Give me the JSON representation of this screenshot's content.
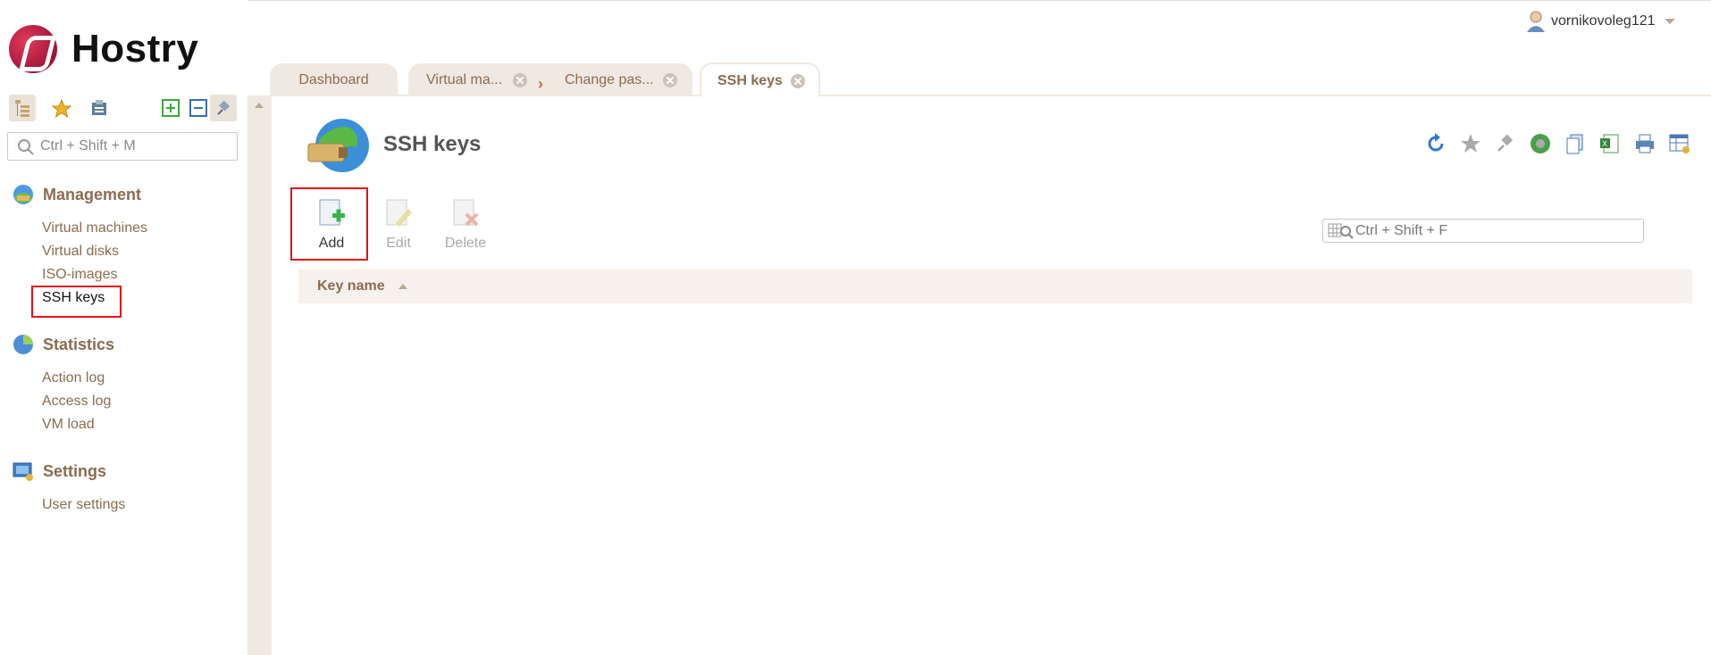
{
  "app": {
    "brand": "Hostry"
  },
  "user": {
    "name": "vornikovoleg121"
  },
  "sidebar": {
    "search_placeholder": "Ctrl + Shift + M",
    "groups": [
      {
        "title": "Management",
        "items": [
          "Virtual machines",
          "Virtual disks",
          "ISO-images",
          "SSH keys"
        ]
      },
      {
        "title": "Statistics",
        "items": [
          "Action log",
          "Access log",
          "VM load"
        ]
      },
      {
        "title": "Settings",
        "items": [
          "User settings"
        ]
      }
    ],
    "selected_item": "SSH keys"
  },
  "tabs": [
    {
      "label": "Dashboard",
      "closable": false
    },
    {
      "label": "Virtual ma...",
      "closable": true
    },
    {
      "label": "Change pas...",
      "closable": true
    },
    {
      "label": "SSH keys",
      "closable": true,
      "active": true
    }
  ],
  "page": {
    "title": "SSH keys",
    "actions": {
      "add": "Add",
      "edit": "Edit",
      "delete": "Delete"
    },
    "grid_search_placeholder": "Ctrl + Shift + F",
    "columns": [
      "Key name"
    ]
  },
  "icons": {
    "toolbar": [
      "refresh-icon",
      "favorite-star-icon",
      "pin-icon",
      "globe-settings-icon",
      "copy-icon",
      "excel-export-icon",
      "print-icon",
      "table-settings-icon"
    ]
  },
  "colors": {
    "accent_brown": "#8b6c4f",
    "highlight_red": "#e0111b",
    "tab_bg": "#efe9e1"
  }
}
